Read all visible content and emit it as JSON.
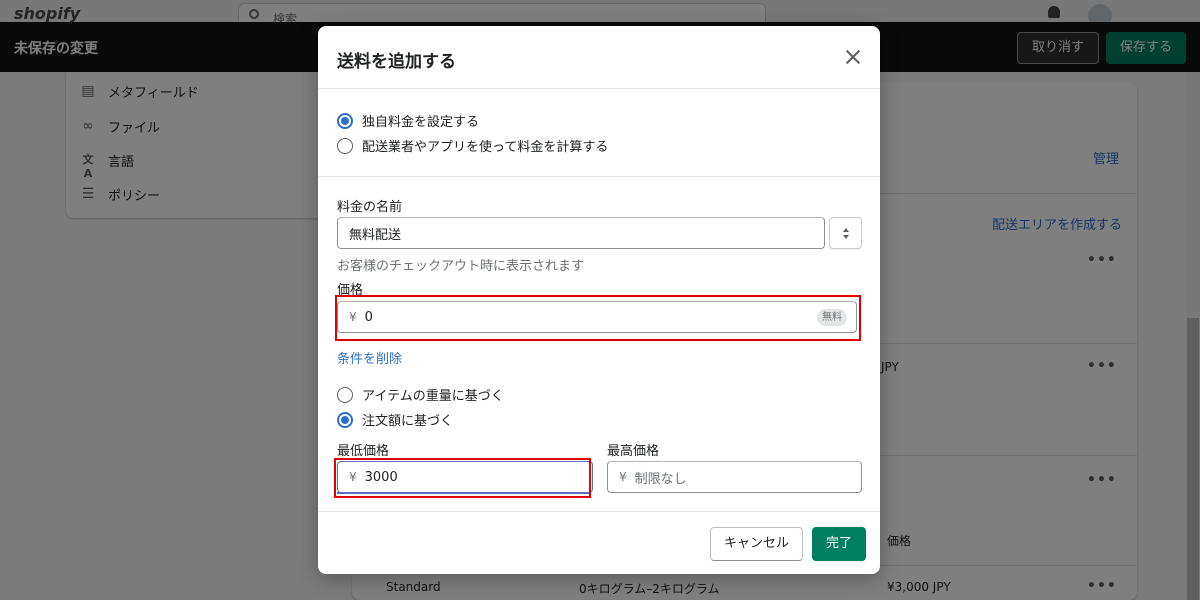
{
  "background": {
    "logo_text": "shopify",
    "search_placeholder": "検索",
    "savebar": {
      "title": "未保存の変更",
      "discard_label": "取り消す",
      "save_label": "保存する"
    },
    "nav_items": [
      {
        "label": "メタフィールド",
        "icon": "metafield-icon"
      },
      {
        "label": "ファイル",
        "icon": "paperclip-icon"
      },
      {
        "label": "言語",
        "icon": "translate-icon"
      },
      {
        "label": "ポリシー",
        "icon": "policy-icon"
      }
    ],
    "manage_link": "管理",
    "create_zone_link": "配送エリアを作成する",
    "partial_jpy": "JPY",
    "column_price": "価格",
    "row": {
      "name": "Standard",
      "condition": "0キログラム–2キログラム",
      "price": "¥3,000 JPY"
    }
  },
  "modal": {
    "title": "送料を追加する",
    "rate_type_options": [
      {
        "label": "独自料金を設定する",
        "checked": true
      },
      {
        "label": "配送業者やアプリを使って料金を計算する",
        "checked": false
      }
    ],
    "rate_name": {
      "label": "料金の名前",
      "value": "無料配送",
      "help": "お客様のチェックアウト時に表示されます"
    },
    "price": {
      "label": "価格",
      "currency": "¥",
      "value": "0",
      "badge": "無料"
    },
    "remove_conditions_link": "条件を削除",
    "condition_options": [
      {
        "label": "アイテムの重量に基づく",
        "checked": false
      },
      {
        "label": "注文額に基づく",
        "checked": true
      }
    ],
    "min_price": {
      "label": "最低価格",
      "currency": "¥",
      "value": "3000"
    },
    "max_price": {
      "label": "最高価格",
      "currency": "¥",
      "placeholder": "制限なし"
    },
    "cancel_label": "キャンセル",
    "done_label": "完了"
  }
}
